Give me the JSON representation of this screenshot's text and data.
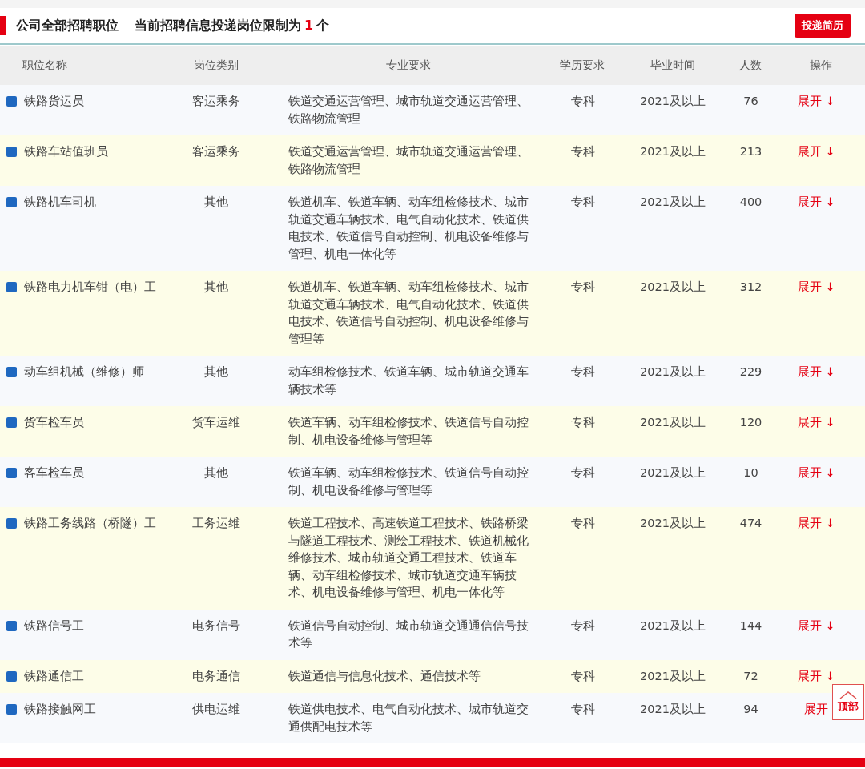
{
  "header": {
    "title": "公司全部招聘职位",
    "limit_prefix": "当前招聘信息投递岗位限制为",
    "limit_count": "1",
    "limit_suffix": "个",
    "submit_button": "投递简历"
  },
  "table": {
    "columns": [
      "职位名称",
      "岗位类别",
      "专业要求",
      "学历要求",
      "毕业时间",
      "人数",
      "操作"
    ],
    "rows": [
      {
        "name": "铁路货运员",
        "category": "客运乘务",
        "major": "铁道交通运营管理、城市轨道交通运营管理、铁路物流管理",
        "education": "专科",
        "graduation": "2021及以上",
        "count": "76",
        "action": "展开",
        "arrow": "↓"
      },
      {
        "name": "铁路车站值班员",
        "category": "客运乘务",
        "major": "铁道交通运营管理、城市轨道交通运营管理、铁路物流管理",
        "education": "专科",
        "graduation": "2021及以上",
        "count": "213",
        "action": "展开",
        "arrow": "↓"
      },
      {
        "name": "铁路机车司机",
        "category": "其他",
        "major": "铁道机车、铁道车辆、动车组检修技术、城市轨道交通车辆技术、电气自动化技术、铁道供电技术、铁道信号自动控制、机电设备维修与管理、机电一体化等",
        "education": "专科",
        "graduation": "2021及以上",
        "count": "400",
        "action": "展开",
        "arrow": "↓"
      },
      {
        "name": "铁路电力机车钳（电）工",
        "category": "其他",
        "major": "铁道机车、铁道车辆、动车组检修技术、城市轨道交通车辆技术、电气自动化技术、铁道供电技术、铁道信号自动控制、机电设备维修与管理等",
        "education": "专科",
        "graduation": "2021及以上",
        "count": "312",
        "action": "展开",
        "arrow": "↓"
      },
      {
        "name": "动车组机械（维修）师",
        "category": "其他",
        "major": "动车组检修技术、铁道车辆、城市轨道交通车辆技术等",
        "education": "专科",
        "graduation": "2021及以上",
        "count": "229",
        "action": "展开",
        "arrow": "↓"
      },
      {
        "name": "货车检车员",
        "category": "货车运维",
        "major": "铁道车辆、动车组检修技术、铁道信号自动控制、机电设备维修与管理等",
        "education": "专科",
        "graduation": "2021及以上",
        "count": "120",
        "action": "展开",
        "arrow": "↓"
      },
      {
        "name": "客车检车员",
        "category": "其他",
        "major": "铁道车辆、动车组检修技术、铁道信号自动控制、机电设备维修与管理等",
        "education": "专科",
        "graduation": "2021及以上",
        "count": "10",
        "action": "展开",
        "arrow": "↓"
      },
      {
        "name": "铁路工务线路（桥隧）工",
        "category": "工务运维",
        "major": "铁道工程技术、高速铁道工程技术、铁路桥梁与隧道工程技术、测绘工程技术、铁道机械化维修技术、城市轨道交通工程技术、铁道车辆、动车组检修技术、城市轨道交通车辆技术、机电设备维修与管理、机电一体化等",
        "education": "专科",
        "graduation": "2021及以上",
        "count": "474",
        "action": "展开",
        "arrow": "↓"
      },
      {
        "name": "铁路信号工",
        "category": "电务信号",
        "major": "铁道信号自动控制、城市轨道交通通信信号技术等",
        "education": "专科",
        "graduation": "2021及以上",
        "count": "144",
        "action": "展开",
        "arrow": "↓"
      },
      {
        "name": "铁路通信工",
        "category": "电务通信",
        "major": "铁道通信与信息化技术、通信技术等",
        "education": "专科",
        "graduation": "2021及以上",
        "count": "72",
        "action": "展开",
        "arrow": "↓"
      },
      {
        "name": "铁路接触网工",
        "category": "供电运维",
        "major": "铁道供电技术、电气自动化技术、城市轨道交通供配电技术等",
        "education": "专科",
        "graduation": "2021及以上",
        "count": "94",
        "action": "展开"
      }
    ]
  },
  "back_to_top": {
    "label": "顶部"
  }
}
